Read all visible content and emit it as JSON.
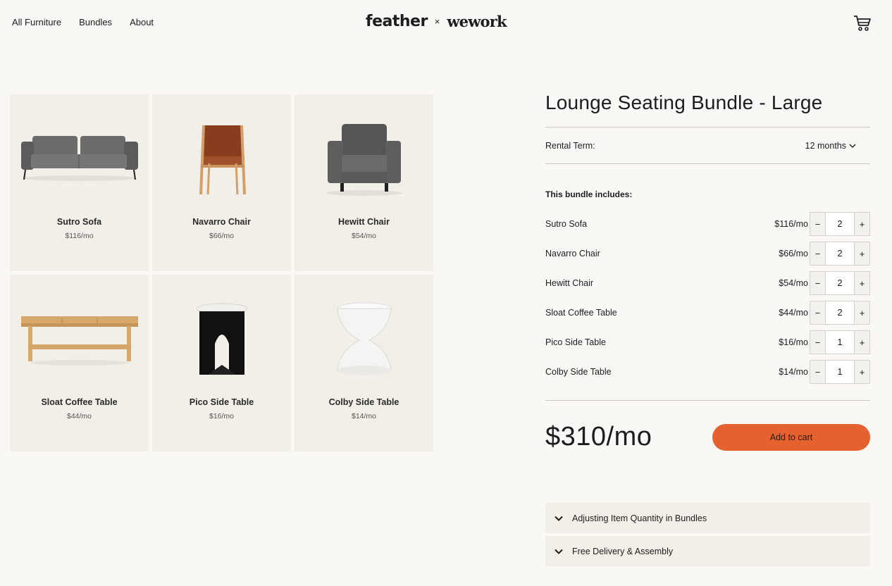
{
  "nav": {
    "items": [
      "All Furniture",
      "Bundles",
      "About"
    ]
  },
  "logo": {
    "left": "feather",
    "sep": "×",
    "right": "wework"
  },
  "grid": {
    "cards": [
      {
        "name": "Sutro Sofa",
        "price": "$116/mo",
        "icon": "sofa-image"
      },
      {
        "name": "Navarro Chair",
        "price": "$66/mo",
        "icon": "navarro-chair-image"
      },
      {
        "name": "Hewitt Chair",
        "price": "$54/mo",
        "icon": "hewitt-chair-image"
      },
      {
        "name": "Sloat Coffee Table",
        "price": "$44/mo",
        "icon": "coffee-table-image"
      },
      {
        "name": "Pico Side Table",
        "price": "$16/mo",
        "icon": "pico-side-table-image"
      },
      {
        "name": "Colby Side Table",
        "price": "$14/mo",
        "icon": "colby-side-table-image"
      }
    ]
  },
  "product": {
    "title": "Lounge Seating Bundle - Large",
    "rental_term_label": "Rental Term:",
    "rental_term_value": "12 months",
    "includes_label": "This bundle includes:",
    "items": [
      {
        "name": "Sutro Sofa",
        "price": "$116/mo",
        "qty": "2"
      },
      {
        "name": "Navarro Chair",
        "price": "$66/mo",
        "qty": "2"
      },
      {
        "name": "Hewitt Chair",
        "price": "$54/mo",
        "qty": "2"
      },
      {
        "name": "Sloat Coffee Table",
        "price": "$44/mo",
        "qty": "2"
      },
      {
        "name": "Pico Side Table",
        "price": "$16/mo",
        "qty": "1"
      },
      {
        "name": "Colby Side Table",
        "price": "$14/mo",
        "qty": "1"
      }
    ],
    "minus": "−",
    "plus": "+",
    "total": "$310/mo",
    "add_to_cart": "Add to cart"
  },
  "accordion": [
    {
      "label": "Adjusting Item Quantity in Bundles"
    },
    {
      "label": "Free Delivery & Assembly"
    }
  ],
  "colors": {
    "accent": "#e5622e",
    "background": "#faf8f5",
    "card": "#f2efe9"
  }
}
